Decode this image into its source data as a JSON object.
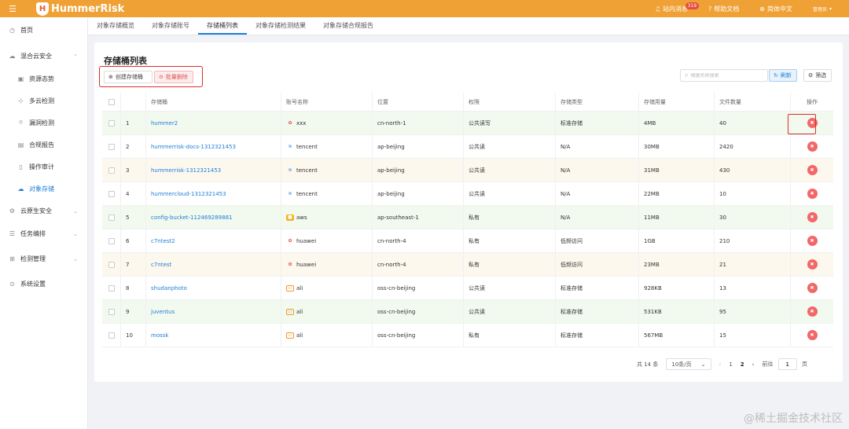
{
  "topbar": {
    "menu_icon": "hamburger-icon",
    "logo_text": "HummerRisk",
    "messages_label": "站内消息",
    "messages_count": "319",
    "help_label": "帮助文档",
    "lang_label": "简体中文",
    "user_label": "管理员"
  },
  "sidebar": {
    "items": [
      {
        "label": "首页",
        "icon": "home-icon"
      },
      {
        "label": "混合云安全",
        "icon": "cloud-icon"
      },
      {
        "label": "资源态势",
        "icon": "monitor-icon"
      },
      {
        "label": "多云检测",
        "icon": "scan-icon"
      },
      {
        "label": "漏洞检测",
        "icon": "bug-icon"
      },
      {
        "label": "合规报告",
        "icon": "report-icon"
      },
      {
        "label": "操作审计",
        "icon": "audit-icon"
      },
      {
        "label": "对象存储",
        "icon": "storage-icon"
      },
      {
        "label": "云原生安全",
        "icon": "gear-icon"
      },
      {
        "label": "任务编排",
        "icon": "list-icon"
      },
      {
        "label": "检测管理",
        "icon": "grid-icon"
      },
      {
        "label": "系统设置",
        "icon": "settings-icon"
      }
    ]
  },
  "tabs": [
    "对象存储概览",
    "对象存储账号",
    "存储桶列表",
    "对象存储检测结果",
    "对象存储合规报告"
  ],
  "page": {
    "title": "存储桶列表",
    "create_label": "创建存储桶",
    "batch_delete_label": "批量删除",
    "search_placeholder": "根据名称搜索",
    "refresh_label": "刷新",
    "filter_label": "筛选"
  },
  "table": {
    "headers": [
      "存储桶",
      "账号名称",
      "位置",
      "权限",
      "存储类型",
      "存储用量",
      "文件数量",
      "操作"
    ],
    "rows": [
      {
        "idx": "1",
        "name": "hummer2",
        "account": "xxx",
        "provider": "huawei",
        "location": "cn-north-1",
        "perm": "公共读写",
        "type": "标准存储",
        "usage": "4MB",
        "files": "40"
      },
      {
        "idx": "2",
        "name": "hummerrisk-docs-1312321453",
        "account": "tencent",
        "provider": "tencent",
        "location": "ap-beijing",
        "perm": "公共读",
        "type": "N/A",
        "usage": "30MB",
        "files": "2420"
      },
      {
        "idx": "3",
        "name": "hummerrisk-1312321453",
        "account": "tencent",
        "provider": "tencent",
        "location": "ap-beijing",
        "perm": "公共读",
        "type": "N/A",
        "usage": "31MB",
        "files": "430"
      },
      {
        "idx": "4",
        "name": "hummercloud-1312321453",
        "account": "tencent",
        "provider": "tencent",
        "location": "ap-beijing",
        "perm": "公共读",
        "type": "N/A",
        "usage": "22MB",
        "files": "10"
      },
      {
        "idx": "5",
        "name": "config-bucket-112469289881",
        "account": "aws",
        "provider": "aws",
        "location": "ap-southeast-1",
        "perm": "私有",
        "type": "N/A",
        "usage": "11MB",
        "files": "30"
      },
      {
        "idx": "6",
        "name": "c7ntest2",
        "account": "huawei",
        "provider": "huawei",
        "location": "cn-north-4",
        "perm": "私有",
        "type": "低频访问",
        "usage": "1GB",
        "files": "210"
      },
      {
        "idx": "7",
        "name": "c7ntest",
        "account": "huawei",
        "provider": "huawei",
        "location": "cn-north-4",
        "perm": "私有",
        "type": "低频访问",
        "usage": "23MB",
        "files": "21"
      },
      {
        "idx": "8",
        "name": "shudanphoto",
        "account": "ali",
        "provider": "ali",
        "location": "oss-cn-beijing",
        "perm": "公共读",
        "type": "标准存储",
        "usage": "928KB",
        "files": "13"
      },
      {
        "idx": "9",
        "name": "juventus",
        "account": "ali",
        "provider": "ali",
        "location": "oss-cn-beijing",
        "perm": "公共读",
        "type": "标准存储",
        "usage": "531KB",
        "files": "95"
      },
      {
        "idx": "10",
        "name": "mossk",
        "account": "ali",
        "provider": "ali",
        "location": "oss-cn-beijing",
        "perm": "私有",
        "type": "标准存储",
        "usage": "567MB",
        "files": "15"
      }
    ]
  },
  "pagination": {
    "total": "共 14 条",
    "page_size": "10条/页",
    "pages": [
      "1",
      "2"
    ],
    "current": "2",
    "goto_label": "前往",
    "goto_value": "1",
    "goto_suffix": "页"
  },
  "watermark": "@稀土掘金技术社区",
  "colors": {
    "brand": "#f0a135",
    "accent": "#1d7ed6",
    "danger": "#f26767"
  }
}
